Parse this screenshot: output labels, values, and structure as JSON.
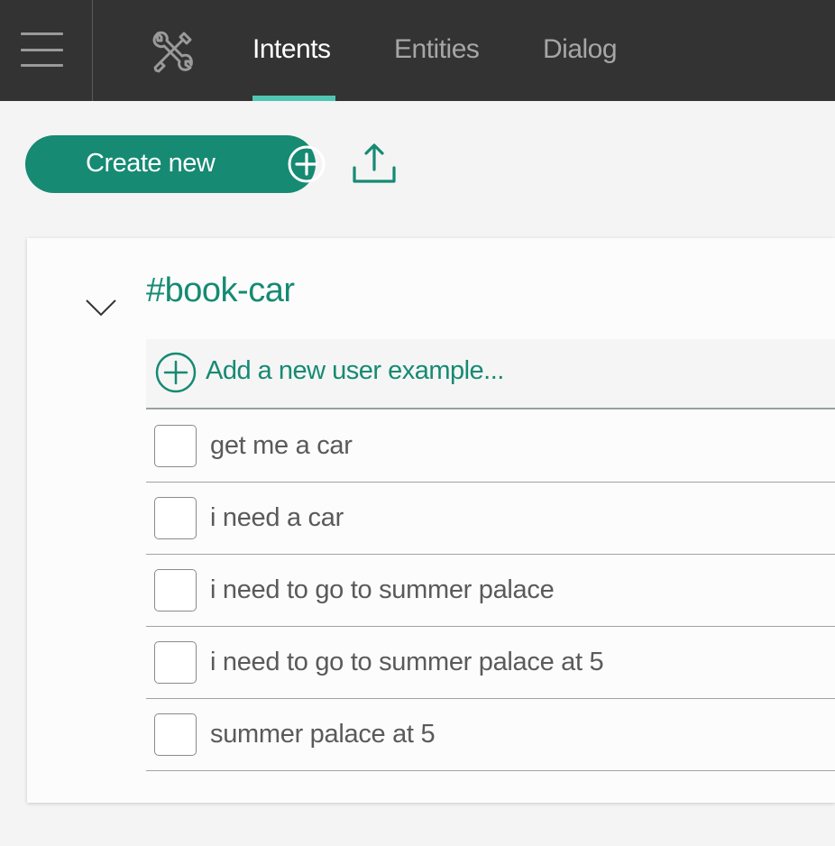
{
  "nav": {
    "tabs": [
      {
        "label": "Intents",
        "active": true
      },
      {
        "label": "Entities",
        "active": false
      },
      {
        "label": "Dialog",
        "active": false
      }
    ],
    "menu_icon": "hamburger-icon",
    "tools_icon": "wrench-screwdriver-icon"
  },
  "toolbar": {
    "create_label": "Create new",
    "create_icon": "plus-circle-icon",
    "upload_icon": "upload-icon"
  },
  "intent": {
    "name": "#book-car",
    "add_placeholder": "Add a new user example...",
    "examples": [
      "get me a car",
      "i need a car",
      "i need to go to summer palace",
      "i need to go to summer palace at 5",
      "summer palace at 5"
    ]
  },
  "colors": {
    "topbar": "#333333",
    "accent": "#168a73",
    "tab_underline": "#4fc6b3"
  }
}
